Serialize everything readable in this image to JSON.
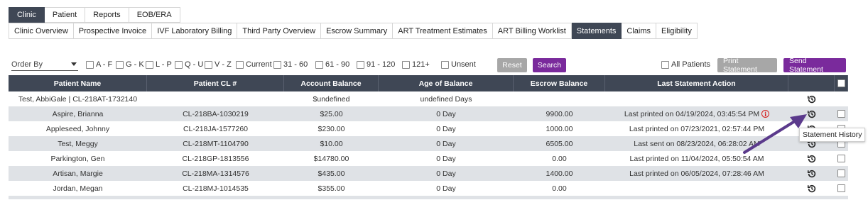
{
  "main_tabs": [
    {
      "label": "Clinic",
      "active": true
    },
    {
      "label": "Patient",
      "active": false
    },
    {
      "label": "Reports",
      "active": false
    },
    {
      "label": "EOB/ERA",
      "active": false
    }
  ],
  "sub_tabs": [
    {
      "label": "Clinic Overview",
      "active": false
    },
    {
      "label": "Prospective Invoice",
      "active": false
    },
    {
      "label": "IVF Laboratory Billing",
      "active": false
    },
    {
      "label": "Third Party Overview",
      "active": false
    },
    {
      "label": "Escrow Summary",
      "active": false
    },
    {
      "label": "ART Treatment Estimates",
      "active": false
    },
    {
      "label": "ART Billing Worklist",
      "active": false
    },
    {
      "label": "Statements",
      "active": true
    },
    {
      "label": "Claims",
      "active": false
    },
    {
      "label": "Eligibility",
      "active": false
    }
  ],
  "toolbar": {
    "order_by_label": "Order By",
    "filters": [
      "A - F",
      "G - K",
      "L - P",
      "Q - U",
      "V - Z",
      "Current",
      "31 - 60",
      "61 - 90",
      "91 - 120",
      "121+",
      "Unsent"
    ],
    "reset_label": "Reset",
    "search_label": "Search",
    "all_patients_label": "All Patients",
    "print_label": "Print Statement",
    "send_label": "Send Statement"
  },
  "table": {
    "headers": [
      "Patient Name",
      "Patient CL #",
      "Account Balance",
      "Age of Balance",
      "Escrow Balance",
      "Last Statement Action"
    ],
    "rows": [
      {
        "name": "Test, AbbiGale | CL-218AT-1732140",
        "cl": "",
        "balance": "$undefined",
        "age": "undefined Days",
        "escrow": "",
        "action": ""
      },
      {
        "name": "Aspire, Brianna",
        "cl": "CL-218BA-1030219",
        "balance": "$25.00",
        "age": "0 Day",
        "escrow": "9900.00",
        "action": "Last printed on 04/19/2024, 03:45:54 PM"
      },
      {
        "name": "Appleseed, Johnny",
        "cl": "CL-218JA-1577260",
        "balance": "$230.00",
        "age": "0 Day",
        "escrow": "1000.00",
        "action": "Last printed on 07/23/2021, 02:57:44 PM"
      },
      {
        "name": "Test, Meggy",
        "cl": "CL-218MT-1104790",
        "balance": "$10.00",
        "age": "0 Day",
        "escrow": "6505.00",
        "action": "Last sent on 08/23/2024, 06:28:02 AM"
      },
      {
        "name": "Parkington, Gen",
        "cl": "CL-218GP-1813556",
        "balance": "$14780.00",
        "age": "0 Day",
        "escrow": "0.00",
        "action": "Last printed on 11/04/2024, 05:50:54 AM"
      },
      {
        "name": "Artisan, Margie",
        "cl": "CL-218MA-1314576",
        "balance": "$435.00",
        "age": "0 Day",
        "escrow": "1400.00",
        "action": "Last printed on 06/05/2024, 07:28:46 AM"
      },
      {
        "name": "Jordan, Megan",
        "cl": "CL-218MJ-1014535",
        "balance": "$355.00",
        "age": "0 Day",
        "escrow": "0.00",
        "action": ""
      }
    ]
  },
  "tooltip": "Statement History",
  "colors": {
    "header_bg": "#3f4755",
    "accent": "#7a2a9c",
    "alt_row": "#dfe2e6",
    "arrow": "#5b3a8c",
    "warning": "#d52020"
  }
}
